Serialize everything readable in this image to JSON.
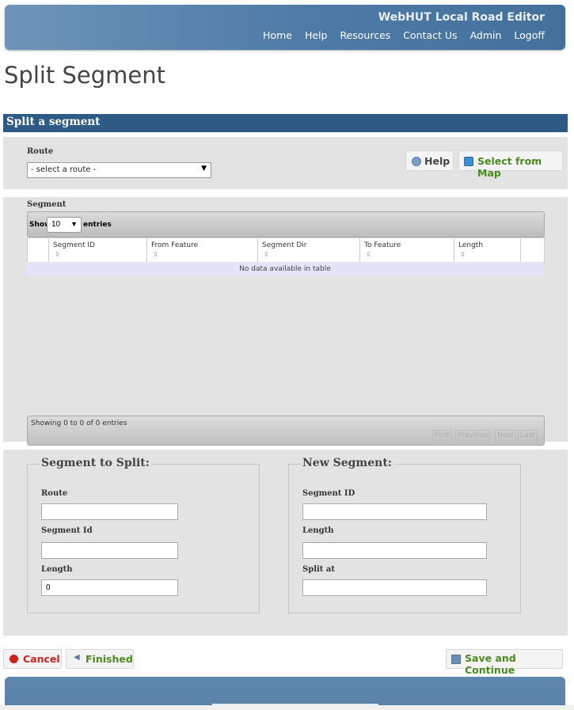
{
  "header": {
    "app_title": "WebHUT Local Road Editor",
    "nav": [
      "Home",
      "Help",
      "Resources",
      "Contact Us",
      "Admin",
      "Logoff"
    ]
  },
  "page_title": "Split Segment",
  "section_bar": "Split a segment",
  "route_panel": {
    "route_label": "Route",
    "route_select_value": "- select a route -",
    "help_button": "Help",
    "map_button": "Select from Map"
  },
  "segment_panel": {
    "label": "Segment",
    "show_label": "Show",
    "page_length": "10",
    "entries_label": "entries",
    "columns": [
      "Segment ID",
      "From Feature",
      "Segment Dir",
      "To Feature",
      "Length"
    ],
    "empty_message": "No data available in table",
    "info": "Showing 0 to 0 of 0 entries",
    "pager": [
      "First",
      "Previous",
      "Next",
      "Last"
    ]
  },
  "split_form": {
    "left_legend": "Segment to Split:",
    "left_fields": [
      {
        "label": "Route",
        "value": ""
      },
      {
        "label": "Segment Id",
        "value": ""
      },
      {
        "label": "Length",
        "value": "0"
      }
    ],
    "right_legend": "New Segment:",
    "right_fields": [
      {
        "label": "Segment ID",
        "value": ""
      },
      {
        "label": "Length",
        "value": ""
      },
      {
        "label": "Split at",
        "value": ""
      }
    ]
  },
  "actions": {
    "cancel": "Cancel",
    "finished": "Finished",
    "save_continue": "Save and Continue"
  },
  "colors": {
    "header_blue": "#4d7aa6",
    "bar_blue": "#2e5a86",
    "cancel_red": "#cc2222",
    "green_text": "#4a8a1e"
  }
}
